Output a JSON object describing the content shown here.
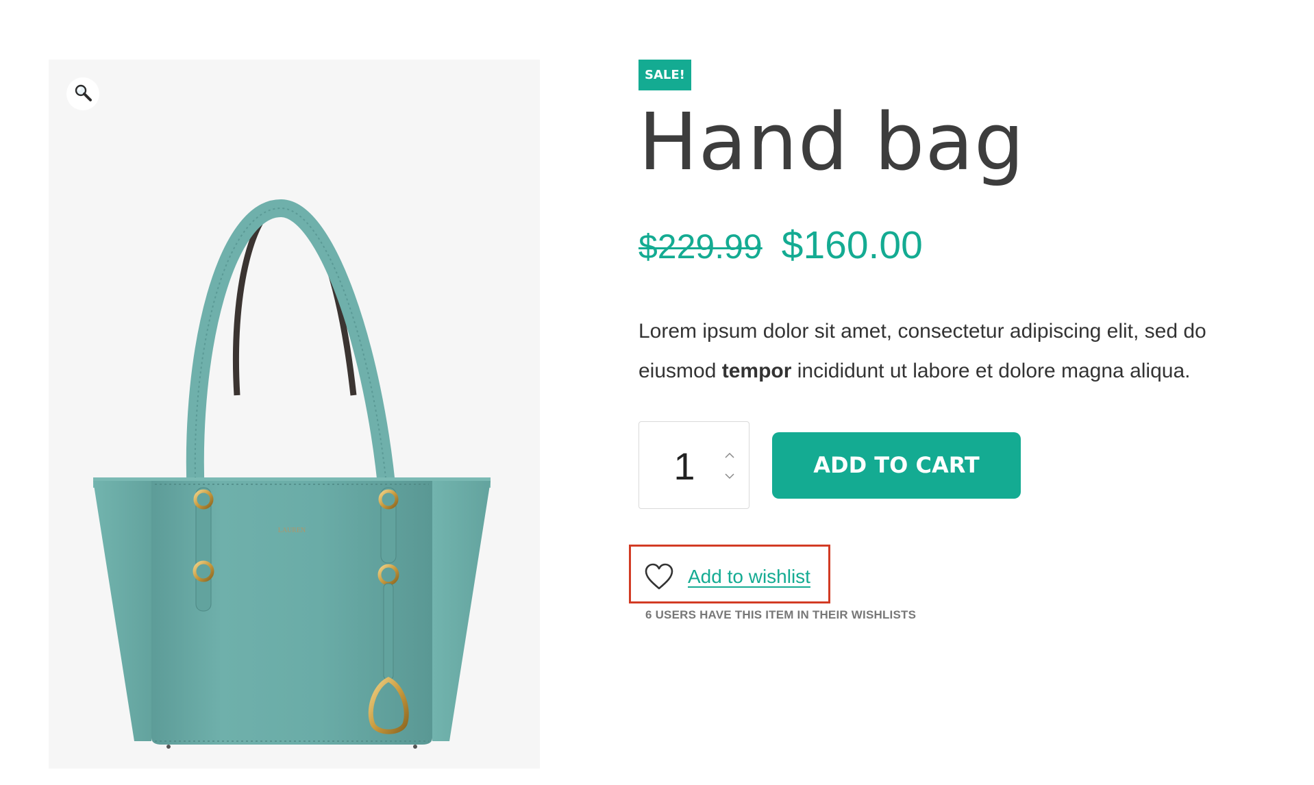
{
  "gallery": {
    "zoom_icon": "magnifier-icon",
    "image": "teal-leather-tote-handbag",
    "brand_color": "#6aa9a6"
  },
  "product": {
    "badge": "SALE!",
    "title": "Hand bag",
    "price_old": "$229.99",
    "price_new": "$160.00",
    "description_part1": "Lorem ipsum dolor sit amet, consectetur adipiscing elit, sed do eiusmod ",
    "description_bold": "tempor",
    "description_part2": " incididunt ut labore et dolore magna aliqua."
  },
  "cart": {
    "quantity": "1",
    "add_to_cart_label": "ADD TO CART",
    "stepper_up_icon": "chevron-up-icon",
    "stepper_down_icon": "chevron-down-icon"
  },
  "wishlist": {
    "icon": "heart-icon",
    "label": "Add to wishlist",
    "count_text": "6 USERS HAVE THIS ITEM IN THEIR WISHLISTS"
  },
  "colors": {
    "accent": "#14ab92",
    "highlight": "#d23b24",
    "text": "#333333",
    "muted": "#777777",
    "gallery_bg": "#f6f6f6"
  }
}
